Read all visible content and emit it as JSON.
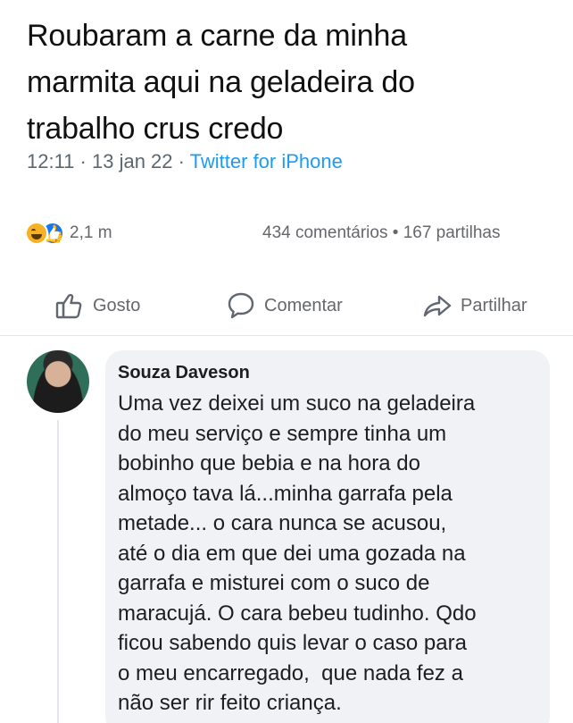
{
  "tweet": {
    "lines": [
      "Roubaram a carne da minha",
      "marmita aqui na geladeira do",
      "trabalho crus credo"
    ],
    "time": "12:11",
    "date": "13 jan 22",
    "separator": " · ",
    "source": "Twitter for iPhone"
  },
  "stats": {
    "reactions_count": "2,1 m",
    "comments": "434 comentários",
    "dot": " • ",
    "shares": "167 partilhas"
  },
  "actions": {
    "like": "Gosto",
    "comment": "Comentar",
    "share": "Partilhar"
  },
  "comment": {
    "author": "Souza Daveson",
    "lines": [
      "Uma vez deixei um suco na geladeira",
      "do meu serviço e sempre tinha um",
      "bobinho que bebia e na hora do",
      "almoço tava lá...minha garrafa pela",
      "metade... o cara nunca se acusou,",
      "até o dia em que dei uma gozada na",
      "garrafa e misturei com o suco de",
      "maracujá. O cara bebeu tudinho. Qdo",
      "ficou sabendo quis levar o caso para",
      "o meu encarregado,  que nada fez a",
      "não ser rir feito criança."
    ]
  },
  "icons": {
    "reaction_1": "haha-reaction-icon",
    "reaction_2": "like-reaction-icon",
    "like": "thumbs-up-icon",
    "comment": "speech-bubble-icon",
    "share": "share-arrow-icon"
  },
  "colors": {
    "link": "#1d9bf0",
    "muted": "#65676b",
    "bubble": "#f0f2f5",
    "like_blue": "#1877f2",
    "haha_yellow": "#f7b125"
  }
}
